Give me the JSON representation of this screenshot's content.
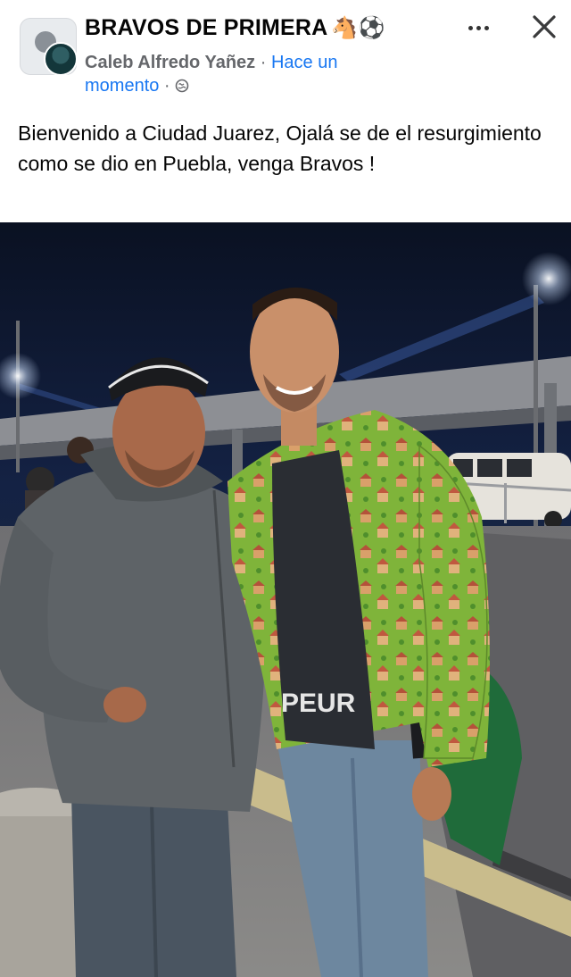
{
  "header": {
    "group_name": "BRAVOS DE PRIMERA",
    "group_emoji": "🐴⚽",
    "author": "Caleb Alfredo Yañez",
    "separator": " · ",
    "time": "Hace un momento",
    "separator2": " · ",
    "privacy_icon": "globe-icon",
    "more_icon": "more-horizontal-icon",
    "close_icon": "close-icon"
  },
  "post": {
    "text": "Bienvenido a Ciudad Juarez, Ojalá se de el resurgimiento como se dio en Puebla, venga Bravos !"
  },
  "photo": {
    "shirt_text": "PEUR",
    "colors": {
      "night_sky": "#0d1524",
      "jacket_green": "#7fb43a",
      "hoodie_gray": "#5e6367",
      "backpack_green": "#1f6b3a"
    }
  },
  "theme": {
    "text": "#050505",
    "secondary": "#65676b",
    "link": "#1877f2"
  }
}
